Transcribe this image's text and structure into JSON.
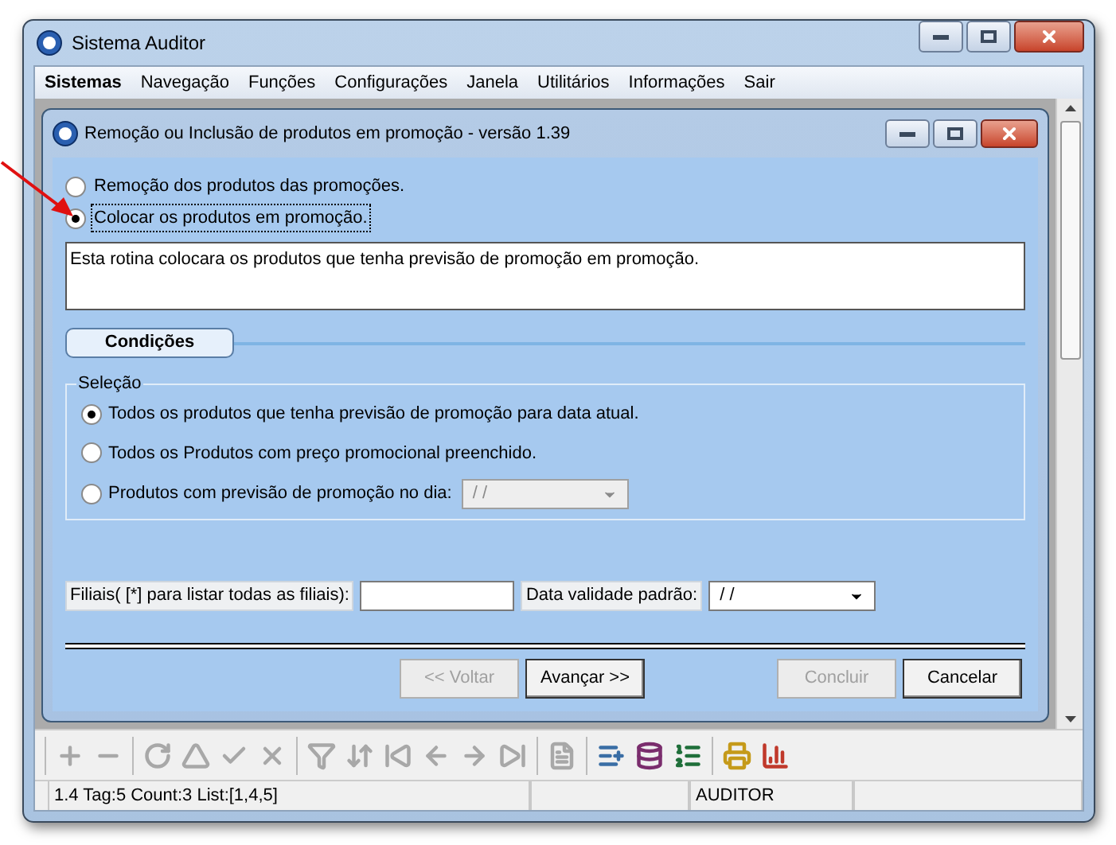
{
  "window": {
    "title": "Sistema Auditor"
  },
  "menu": [
    {
      "label": "Sistemas",
      "selected": true
    },
    {
      "label": "Navegação",
      "selected": false
    },
    {
      "label": "Funções",
      "selected": false
    },
    {
      "label": "Configurações",
      "selected": false
    },
    {
      "label": "Janela",
      "selected": false
    },
    {
      "label": "Utilitários",
      "selected": false
    },
    {
      "label": "Informações",
      "selected": false
    },
    {
      "label": "Sair",
      "selected": false
    }
  ],
  "dialog": {
    "title": "Remoção ou Inclusão de produtos em promoção - versão 1.39",
    "mode_options": [
      {
        "label": "Remoção dos produtos das promoções.",
        "selected": false
      },
      {
        "label": "Colocar os produtos em promoção.",
        "selected": true
      }
    ],
    "description": "Esta rotina colocara os produtos que tenha previsão de promoção em promoção.",
    "section_tab": "Condições",
    "group": {
      "title": "Seleção",
      "options": [
        {
          "label": "Todos os produtos que tenha previsão de promoção para data atual.",
          "selected": true
        },
        {
          "label": "Todos os Produtos com preço promocional preenchido.",
          "selected": false
        },
        {
          "label": "Produtos com previsão de promoção no dia:",
          "selected": false,
          "date": "/ /",
          "disabled": true
        }
      ]
    },
    "filiais_label": "Filiais( [*] para listar todas as filiais):",
    "data_label": "Data validade padrão:",
    "data_value": "/ /",
    "buttons": [
      {
        "label": "<< Voltar",
        "disabled": true
      },
      {
        "label": "Avançar >>",
        "disabled": false
      },
      {
        "label": "Concluir",
        "disabled": true
      },
      {
        "label": "Cancelar",
        "disabled": false
      }
    ]
  },
  "toolbar": [
    [
      {
        "disabled": true
      },
      {
        "disabled": true
      }
    ],
    [
      {
        "disabled": true
      },
      {
        "disabled": true
      },
      {
        "disabled": true
      },
      {
        "disabled": true
      }
    ],
    [
      {
        "disabled": true
      },
      {
        "disabled": true
      },
      {
        "disabled": true
      },
      {
        "disabled": true
      },
      {
        "disabled": true
      },
      {
        "disabled": true
      }
    ],
    [
      {
        "disabled": true
      }
    ],
    [
      {
        "disabled": false
      },
      {
        "disabled": false
      },
      {
        "disabled": false
      }
    ],
    [
      {
        "disabled": false
      },
      {
        "disabled": false
      }
    ]
  ],
  "status_bar": [
    "1.4 Tag:5 Count:3 List:[1,4,5]",
    "AUDITOR"
  ]
}
